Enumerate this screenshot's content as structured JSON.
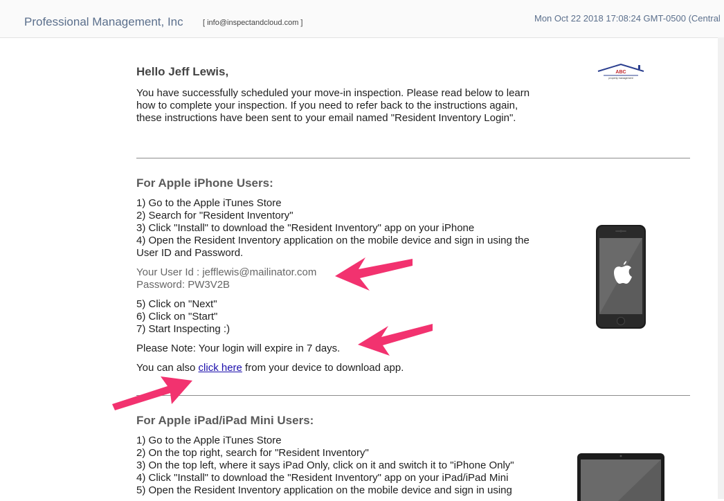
{
  "header": {
    "sender": "Professional Management, Inc",
    "sender_email": "[ info@inspectandcloud.com ]",
    "date": "Mon Oct 22 2018 17:08:24 GMT-0500 (Central"
  },
  "logo": {
    "text": "ABC",
    "subtext": "property management"
  },
  "greeting": "Hello Jeff Lewis,",
  "intro": "You have successfully scheduled your move-in inspection. Please read below to learn how to complete your inspection. If you need to refer back to the instructions again, these instructions have been sent to your email named \"Resident Inventory Login\".",
  "iphone": {
    "title": "For Apple iPhone Users:",
    "steps": [
      "1) Go to the Apple iTunes Store",
      "2) Search for \"Resident Inventory\"",
      "3) Click \"Install\" to download the \"Resident Inventory\" app on your iPhone",
      "4) Open the Resident Inventory application on the mobile device and sign in using the User ID and Password."
    ],
    "user_id": "Your User Id : jefflewis@mailinator.com",
    "password": "Password: PW3V2B",
    "steps2": [
      "5) Click on \"Next\"",
      "6) Click on \"Start\"",
      "7) Start Inspecting :)"
    ],
    "note": "Please Note: Your login will expire in 7 days.",
    "download_prefix": "You can also ",
    "download_link": "click here",
    "download_suffix": " from your device to download app."
  },
  "ipad": {
    "title": "For Apple iPad/iPad Mini Users:",
    "steps": [
      "1) Go to the Apple iTunes Store",
      "2) On the top right, search for \"Resident Inventory\"",
      "3) On the top left, where it says iPad Only, click on it and switch it to \"iPhone Only\"",
      "4) Click \"Install\" to download the \"Resident Inventory\" app on your iPad/iPad Mini",
      "5) Open the Resident Inventory application on the mobile device and sign in using"
    ]
  },
  "colors": {
    "annotation_arrow": "#f2326f",
    "link": "#1a0dab",
    "header_text": "#5b6f8c"
  },
  "icons": {
    "iphone": "iphone-apple-icon",
    "ipad": "ipad-icon",
    "logo": "abc-house-logo"
  }
}
